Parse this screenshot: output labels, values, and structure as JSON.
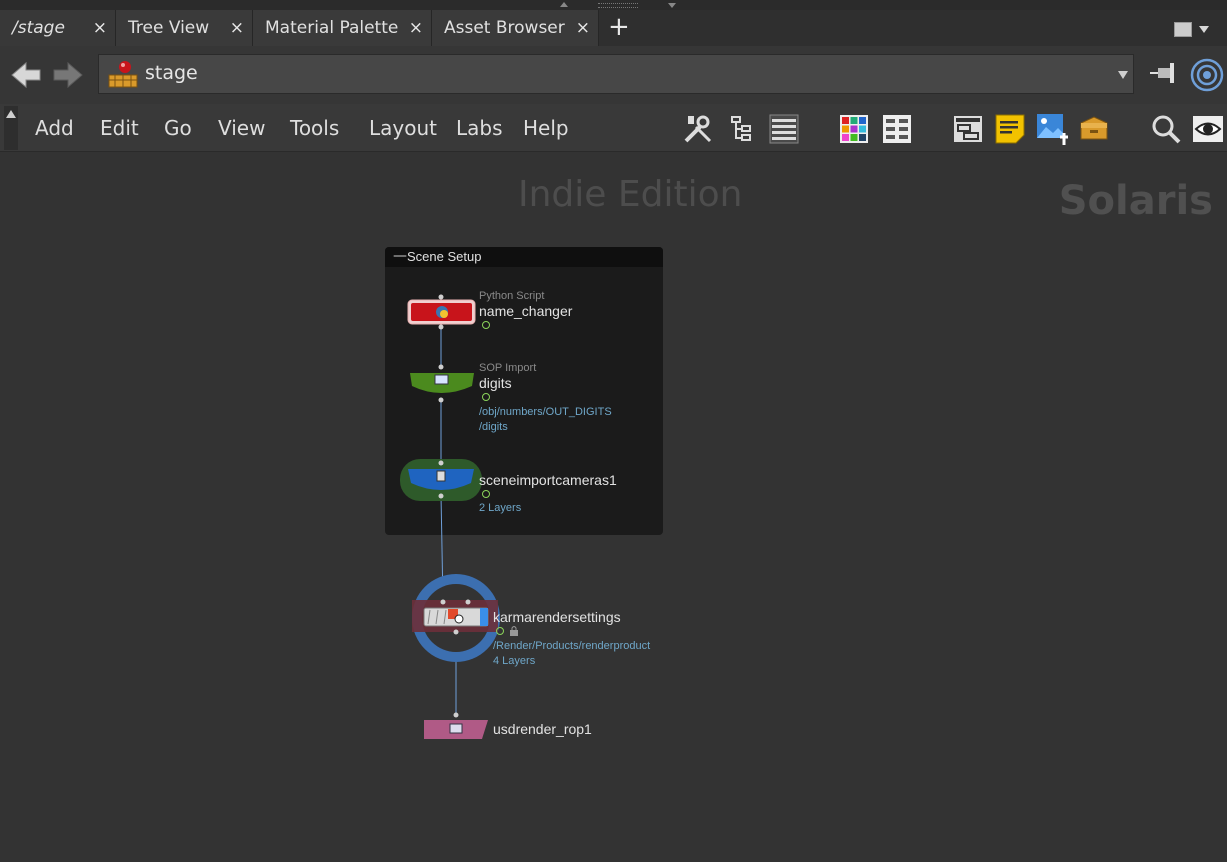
{
  "tabs": [
    {
      "label": "/stage",
      "close": "×"
    },
    {
      "label": "Tree View",
      "close": "×"
    },
    {
      "label": "Material Palette",
      "close": "×"
    },
    {
      "label": "Asset Browser",
      "close": "×"
    }
  ],
  "tab_add_label": "+",
  "path": {
    "value": "stage"
  },
  "menu": [
    "Add",
    "Edit",
    "Go",
    "View",
    "Tools",
    "Layout",
    "Labs",
    "Help"
  ],
  "toolbar_icons": [
    "wrench-icon",
    "tree-icon",
    "list-icon",
    "color-grid-icon",
    "shape-palette-icon",
    "network-box-icon",
    "sticky-note-icon",
    "background-image-icon",
    "subnet-icon",
    "search-icon",
    "eye-icon"
  ],
  "watermark": {
    "edition": "Indie Edition",
    "context": "Solaris"
  },
  "network_box": {
    "title": "Scene Setup",
    "collapse": "—"
  },
  "nodes": {
    "name_changer": {
      "type": "Python Script",
      "name": "name_changer",
      "color": "#c8141b"
    },
    "digits": {
      "type": "SOP Import",
      "name": "digits",
      "info1": "/obj/numbers/OUT_DIGITS",
      "info2": "/digits",
      "color": "#4b8a1e"
    },
    "sceneimport": {
      "name": "sceneimportcameras1",
      "info1": "2 Layers",
      "color": "#1f64c0"
    },
    "karma": {
      "name": "karmarendersettings",
      "info1": "/Render/Products/renderproduct",
      "info2": "4 Layers"
    },
    "usdrender": {
      "name": "usdrender_rop1",
      "color": "#b05a86"
    }
  },
  "colors": {
    "accent_blue": "#3c6fb0",
    "info_blue": "#6fa7c9",
    "background": "#333333"
  }
}
